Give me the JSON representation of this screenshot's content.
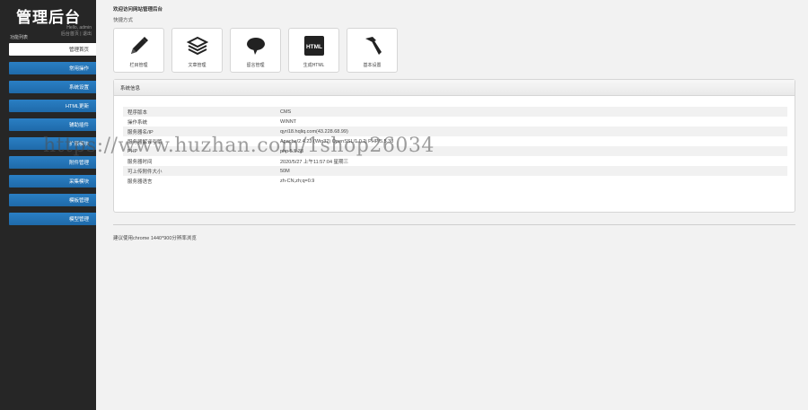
{
  "sidebar": {
    "logo": "管理后台",
    "greeting": "Hello, admin",
    "home_link": "后台首页",
    "separator": " | ",
    "logout_link": "退出",
    "nav_title": "功能列表",
    "items": [
      {
        "label": "管理首页",
        "active": true
      },
      {
        "label": "常用操作"
      },
      {
        "label": "系统设置"
      },
      {
        "label": "HTML更新"
      },
      {
        "label": "辅助插件"
      },
      {
        "label": "扩展模块"
      },
      {
        "label": "附件管理"
      },
      {
        "label": "采集模块"
      },
      {
        "label": "模板管理"
      },
      {
        "label": "模型管理"
      }
    ]
  },
  "main": {
    "welcome": "欢迎访问网站管理后台",
    "shortcut_title": "快捷方式",
    "shortcuts": [
      {
        "label": "栏目管理",
        "icon": "pencil-icon"
      },
      {
        "label": "文章管理",
        "icon": "stack-icon"
      },
      {
        "label": "留言管理",
        "icon": "speech-bubble-icon"
      },
      {
        "label": "生成HTML",
        "icon": "html-icon",
        "badge": "HTML"
      },
      {
        "label": "基本设置",
        "icon": "hammer-icon"
      }
    ],
    "panel_title": "系统信息",
    "info_rows": [
      {
        "key": "程序版本",
        "value": "CMS"
      },
      {
        "key": "操作系统",
        "value": "WINNT"
      },
      {
        "key": "服务器名/IP",
        "value": "qyri18.hqliq.com(43.228.68.99)"
      },
      {
        "key": "服务器解译引擎",
        "value": "Apache/2.4.23 (Win32) OpenSSL/1.0.2j PHP/5.5.38"
      },
      {
        "key": "PHP",
        "value": "php 5.5.38"
      },
      {
        "key": "服务器时间",
        "value": "2020/5/27 上午11:57:04 星期三"
      },
      {
        "key": "可上传附件大小",
        "value": "50M"
      },
      {
        "key": "服务器语言",
        "value": "zh-CN,zh;q=0.9"
      }
    ],
    "footnote": "建议使用chrome 1440*900分辨率浏览"
  },
  "watermark": "https://www.huzhan.com/1shop26034"
}
